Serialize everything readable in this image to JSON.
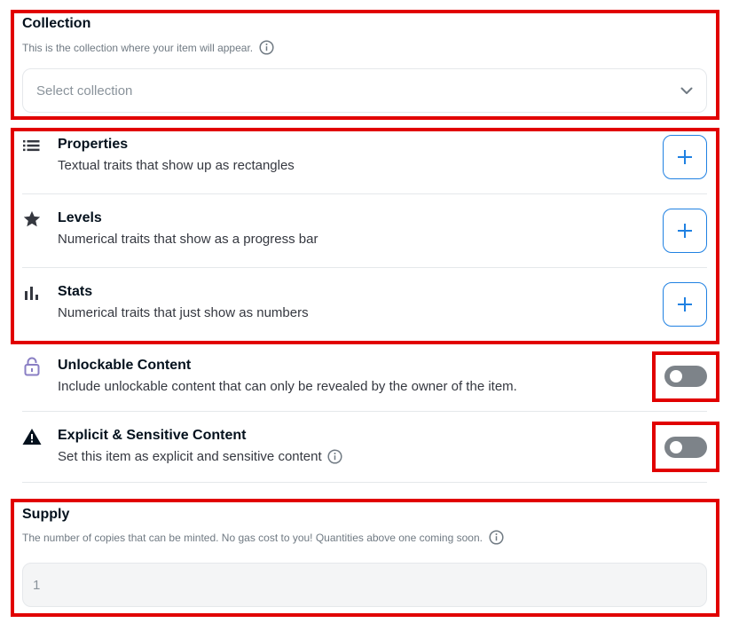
{
  "collection": {
    "title": "Collection",
    "subtitle": "This is the collection where your item will appear.",
    "select_placeholder": "Select collection"
  },
  "traits": [
    {
      "title": "Properties",
      "description": "Textual traits that show up as rectangles",
      "icon": "list-icon"
    },
    {
      "title": "Levels",
      "description": "Numerical traits that show as a progress bar",
      "icon": "star-icon"
    },
    {
      "title": "Stats",
      "description": "Numerical traits that just show as numbers",
      "icon": "bar-chart-icon"
    }
  ],
  "unlockable": {
    "title": "Unlockable Content",
    "description": "Include unlockable content that can only be revealed by the owner of the item.",
    "icon": "lock-icon",
    "enabled": false
  },
  "explicit": {
    "title": "Explicit & Sensitive Content",
    "description": "Set this item as explicit and sensitive content",
    "icon": "warning-icon",
    "enabled": false
  },
  "supply": {
    "title": "Supply",
    "subtitle": "The number of copies that can be minted. No gas cost to you! Quantities above one coming soon.",
    "value": "1"
  },
  "colors": {
    "highlight": "#e10000",
    "accent": "#2081e2",
    "toggle_off": "#7d8389",
    "lock_icon": "#8a7fc4"
  }
}
